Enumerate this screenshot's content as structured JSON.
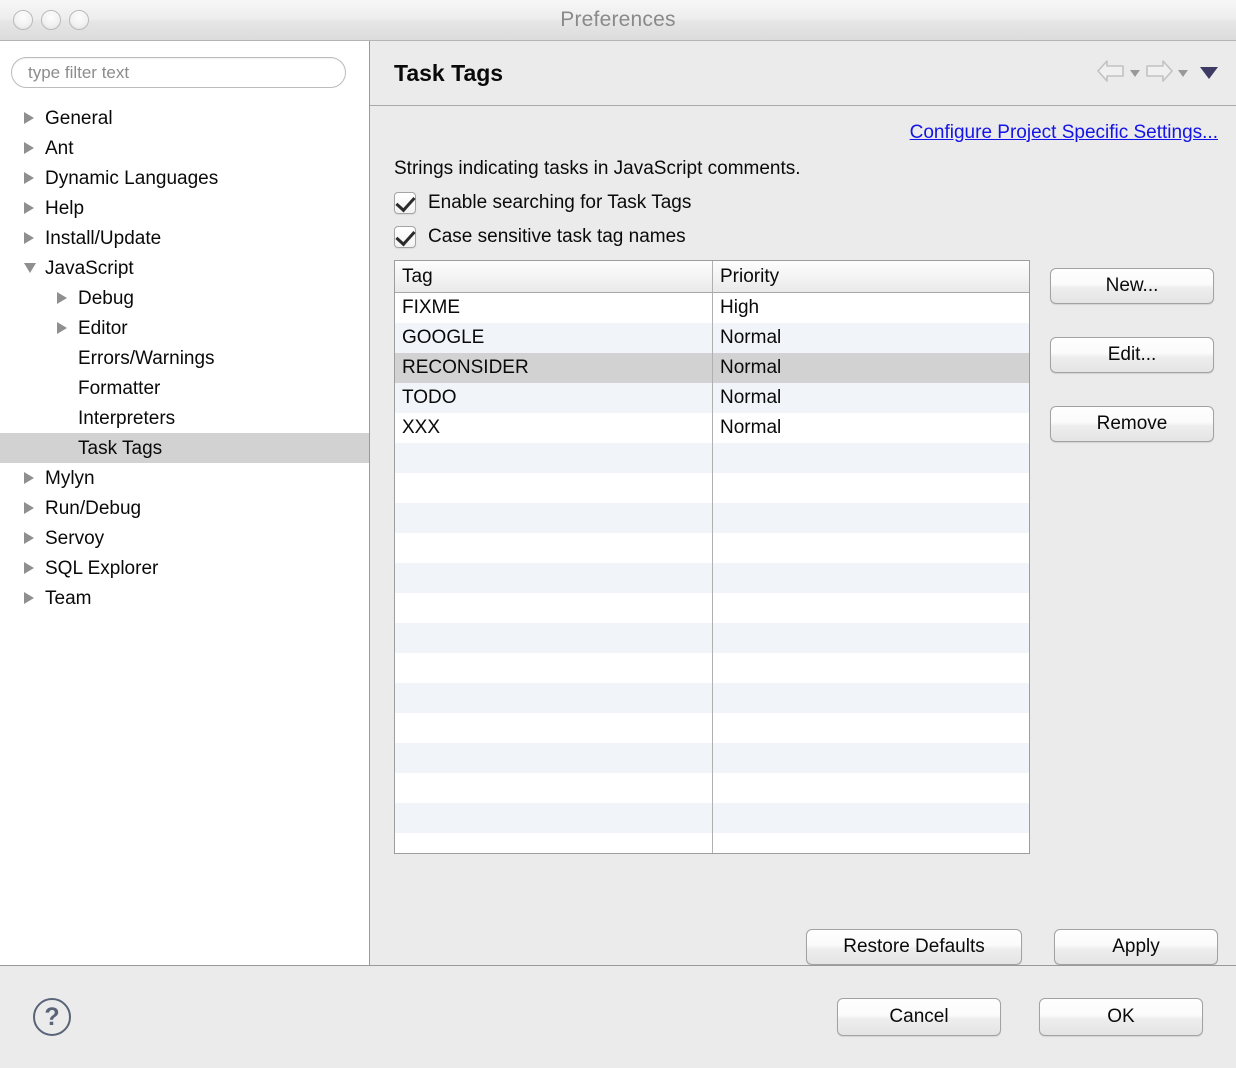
{
  "window": {
    "title": "Preferences",
    "traffic_lights": [
      "close-button",
      "minimize-button",
      "zoom-button"
    ]
  },
  "sidebar": {
    "filter": {
      "placeholder": "type filter text",
      "value": ""
    },
    "items": [
      {
        "label": "General",
        "depth": 1,
        "state": "collapsed",
        "selected": false
      },
      {
        "label": "Ant",
        "depth": 1,
        "state": "collapsed",
        "selected": false
      },
      {
        "label": "Dynamic Languages",
        "depth": 1,
        "state": "collapsed",
        "selected": false
      },
      {
        "label": "Help",
        "depth": 1,
        "state": "collapsed",
        "selected": false
      },
      {
        "label": "Install/Update",
        "depth": 1,
        "state": "collapsed",
        "selected": false
      },
      {
        "label": "JavaScript",
        "depth": 1,
        "state": "expanded",
        "selected": false
      },
      {
        "label": "Debug",
        "depth": 2,
        "state": "collapsed",
        "selected": false
      },
      {
        "label": "Editor",
        "depth": 2,
        "state": "collapsed",
        "selected": false
      },
      {
        "label": "Errors/Warnings",
        "depth": 2,
        "state": "leaf",
        "selected": false
      },
      {
        "label": "Formatter",
        "depth": 2,
        "state": "leaf",
        "selected": false
      },
      {
        "label": "Interpreters",
        "depth": 2,
        "state": "leaf",
        "selected": false
      },
      {
        "label": "Task Tags",
        "depth": 2,
        "state": "leaf",
        "selected": true
      },
      {
        "label": "Mylyn",
        "depth": 1,
        "state": "collapsed",
        "selected": false
      },
      {
        "label": "Run/Debug",
        "depth": 1,
        "state": "collapsed",
        "selected": false
      },
      {
        "label": "Servoy",
        "depth": 1,
        "state": "collapsed",
        "selected": false
      },
      {
        "label": "SQL Explorer",
        "depth": 1,
        "state": "collapsed",
        "selected": false
      },
      {
        "label": "Team",
        "depth": 1,
        "state": "collapsed",
        "selected": false
      }
    ]
  },
  "page": {
    "title": "Task Tags",
    "nav": {
      "back_icon": "arrow-left-icon",
      "back_menu_icon": "chevron-down-icon",
      "forward_icon": "arrow-right-icon",
      "forward_menu_icon": "chevron-down-icon",
      "menu_icon": "triangle-down-icon"
    },
    "configure_link": "Configure Project Specific Settings...",
    "description": "Strings indicating tasks in JavaScript comments.",
    "checkboxes": [
      {
        "label": "Enable searching for Task Tags",
        "checked": true
      },
      {
        "label": "Case sensitive task tag names",
        "checked": true
      }
    ],
    "table": {
      "columns": [
        "Tag",
        "Priority"
      ],
      "rows": [
        {
          "tag": "FIXME",
          "priority": "High",
          "selected": false
        },
        {
          "tag": "GOOGLE",
          "priority": "Normal",
          "selected": false
        },
        {
          "tag": "RECONSIDER",
          "priority": "Normal",
          "selected": true
        },
        {
          "tag": "TODO",
          "priority": "Normal",
          "selected": false
        },
        {
          "tag": "XXX",
          "priority": "Normal",
          "selected": false
        }
      ],
      "empty_row_count": 14
    },
    "side_buttons": [
      {
        "label": "New...",
        "name": "new-button"
      },
      {
        "label": "Edit...",
        "name": "edit-button"
      },
      {
        "label": "Remove",
        "name": "remove-button"
      }
    ],
    "restore_defaults_label": "Restore Defaults",
    "apply_label": "Apply"
  },
  "footer": {
    "help_icon": "question-mark-icon",
    "help_glyph": "?",
    "cancel_label": "Cancel",
    "ok_label": "OK"
  },
  "colors": {
    "link": "#1414e6",
    "selection": "#d2d2d2",
    "panel_bg": "#ebebeb",
    "tree_bg": "#ffffff",
    "row_stripe": "#f1f5f9",
    "menu_triangle": "#3d3b63"
  }
}
